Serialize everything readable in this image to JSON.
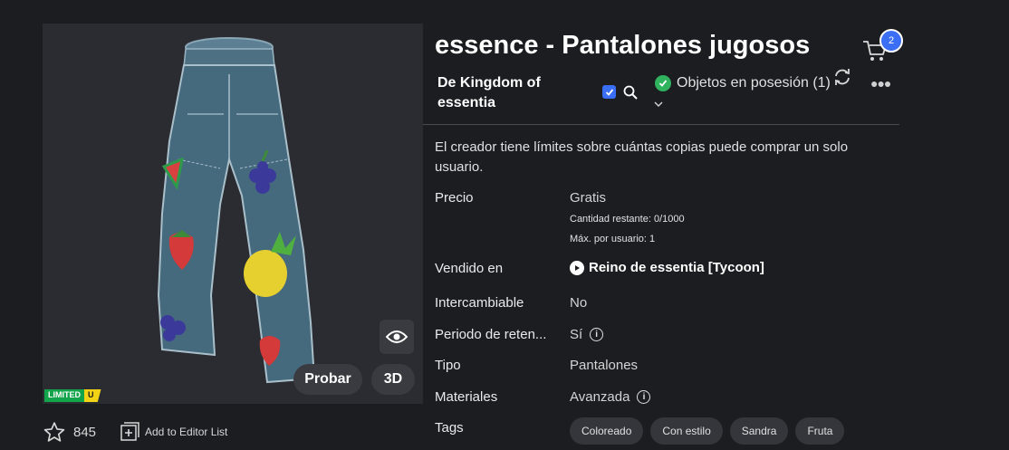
{
  "item": {
    "title": "essence - Pantalones jugosos",
    "creator": "De Kingdom of essentia",
    "owned_text": "Objetos en posesión (1)",
    "notice": "El creador tiene límites sobre cuántas copias puede comprar un solo usuario."
  },
  "cart": {
    "badge": "2",
    "icon": "cart-icon"
  },
  "preview": {
    "try_label": "Probar",
    "three_d_label": "3D",
    "limited_label": "LIMITED",
    "limited_u": "U",
    "icons": [
      "eye-icon"
    ]
  },
  "social": {
    "favorites": "845",
    "editor_list": "Add to Editor List"
  },
  "details": {
    "price_label": "Precio",
    "price_value": "Gratis",
    "remaining": "Cantidad restante: 0/1000",
    "max_per_user": "Máx. por usuario: 1",
    "sold_in_label": "Vendido en",
    "sold_in_value": "Reino de essentia [Tycoon]",
    "tradable_label": "Intercambiable",
    "tradable_value": "No",
    "hold_label": "Periodo de reten...",
    "hold_value": "Sí",
    "type_label": "Tipo",
    "type_value": "Pantalones",
    "materials_label": "Materiales",
    "materials_value": "Avanzada",
    "tags_label": "Tags"
  },
  "tags": [
    "Coloreado",
    "Con estilo",
    "Sandra",
    "Fruta"
  ],
  "colors": {
    "accent": "#3a6ef5",
    "owned_check": "#2fb35c",
    "limited_green": "#12a44b",
    "limited_yellow": "#f2d214"
  }
}
